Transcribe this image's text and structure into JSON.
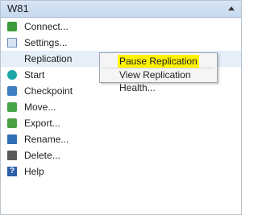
{
  "header": {
    "title": "W81"
  },
  "menu": {
    "items": [
      {
        "label": "Connect...",
        "icon": "connect-icon"
      },
      {
        "label": "Settings...",
        "icon": "settings-icon"
      },
      {
        "label": "Replication",
        "icon": ""
      },
      {
        "label": "Start",
        "icon": "start-icon"
      },
      {
        "label": "Checkpoint",
        "icon": "checkpoint-icon"
      },
      {
        "label": "Move...",
        "icon": "move-icon"
      },
      {
        "label": "Export...",
        "icon": "export-icon"
      },
      {
        "label": "Rename...",
        "icon": "rename-icon"
      },
      {
        "label": "Delete...",
        "icon": "delete-icon"
      },
      {
        "label": "Help",
        "icon": "help-icon"
      }
    ]
  },
  "submenu": {
    "items": [
      {
        "label": "Pause Replication",
        "highlighted": true
      },
      {
        "label": "View Replication Health...",
        "highlighted": false
      }
    ]
  },
  "colors": {
    "header_bg": "#c6d9ee",
    "highlight": "#fff200"
  }
}
